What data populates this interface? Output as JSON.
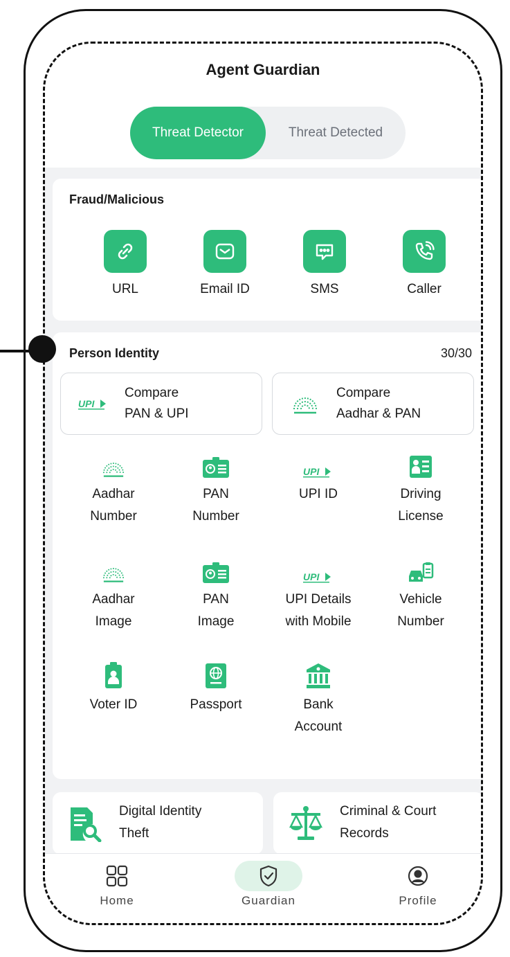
{
  "app": {
    "title": "Agent Guardian"
  },
  "tabs": [
    {
      "label": "Threat Detector",
      "active": true
    },
    {
      "label": "Threat Detected",
      "active": false
    }
  ],
  "colors": {
    "accent": "#2ebc7b",
    "accent_light": "#dff3e8",
    "background": "#f1f2f4"
  },
  "fraud": {
    "title": "Fraud/Malicious",
    "items": [
      {
        "label": "URL",
        "icon": "link-icon"
      },
      {
        "label": "Email ID",
        "icon": "mail-icon"
      },
      {
        "label": "SMS",
        "icon": "message-icon"
      },
      {
        "label": "Caller",
        "icon": "phone-icon"
      }
    ]
  },
  "person": {
    "title": "Person Identity",
    "count": "30/30",
    "compare": [
      {
        "line1": "Compare",
        "line2": "PAN & UPI",
        "icon": "upi-logo-icon"
      },
      {
        "line1": "Compare",
        "line2": "Aadhar & PAN",
        "icon": "aadhaar-logo-icon"
      }
    ],
    "items": [
      {
        "line1": "Aadhar",
        "line2": "Number",
        "icon": "aadhaar-logo-icon"
      },
      {
        "line1": "PAN",
        "line2": "Number",
        "icon": "pan-card-icon"
      },
      {
        "line1": "UPI ID",
        "line2": "",
        "icon": "upi-logo-icon"
      },
      {
        "line1": "Driving",
        "line2": "License",
        "icon": "driving-license-icon"
      },
      {
        "line1": "Aadhar",
        "line2": "Image",
        "icon": "aadhaar-logo-icon"
      },
      {
        "line1": "PAN",
        "line2": "Image",
        "icon": "pan-card-icon"
      },
      {
        "line1": "UPI Details",
        "line2": "with Mobile",
        "icon": "upi-logo-icon"
      },
      {
        "line1": "Vehicle",
        "line2": "Number",
        "icon": "vehicle-icon"
      },
      {
        "line1": "Voter ID",
        "line2": "",
        "icon": "voter-id-icon"
      },
      {
        "line1": "Passport",
        "line2": "",
        "icon": "passport-icon"
      },
      {
        "line1": "Bank",
        "line2": "Account",
        "icon": "bank-icon"
      }
    ]
  },
  "bottom_cards": [
    {
      "line1": "Digital Identity",
      "line2": "Theft",
      "icon": "document-search-icon"
    },
    {
      "line1": "Criminal & Court",
      "line2": "Records",
      "icon": "scales-icon"
    }
  ],
  "nav": [
    {
      "label": "Home",
      "icon": "grid-icon",
      "active": false
    },
    {
      "label": "Guardian",
      "icon": "shield-check-icon",
      "active": true
    },
    {
      "label": "Profile",
      "icon": "user-circle-icon",
      "active": false
    }
  ]
}
